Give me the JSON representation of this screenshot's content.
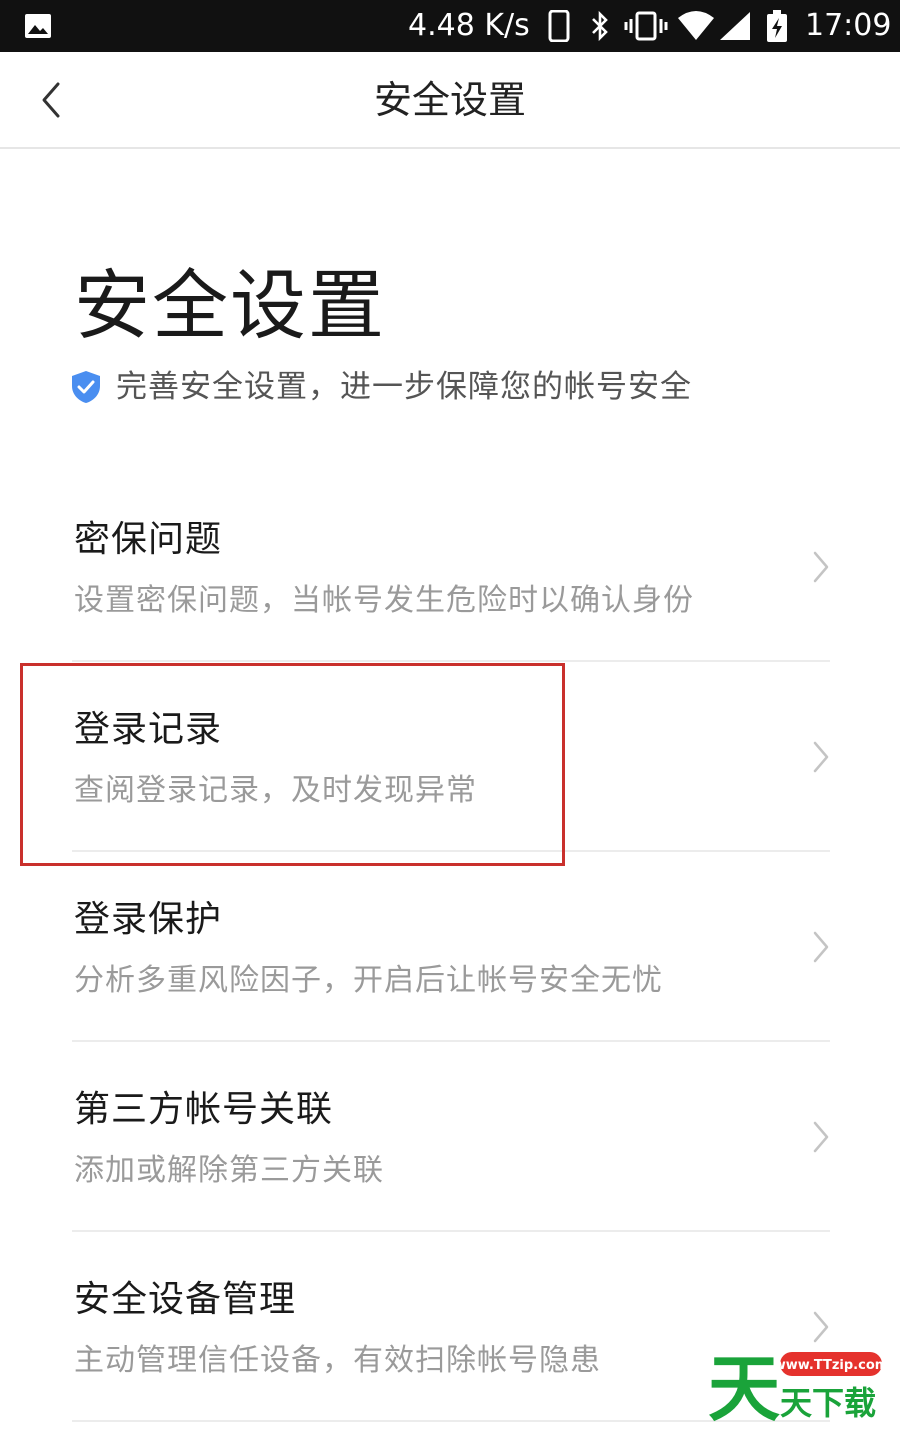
{
  "status_bar": {
    "net_speed": "4.48 K/s",
    "time": "17:09",
    "icons": [
      "gallery-icon",
      "phone-icon",
      "bluetooth-icon",
      "vibrate-icon",
      "wifi-icon",
      "signal-icon",
      "battery-charging-icon"
    ]
  },
  "nav": {
    "title": "安全设置",
    "back_icon": "chevron-left-icon"
  },
  "header": {
    "heading": "安全设置",
    "subtitle": "完善安全设置，进一步保障您的帐号安全",
    "subtitle_icon": "shield-check-icon"
  },
  "items": [
    {
      "title": "密保问题",
      "desc": "设置密保问题，当帐号发生危险时以确认身份"
    },
    {
      "title": "登录记录",
      "desc": "查阅登录记录，及时发现异常"
    },
    {
      "title": "登录保护",
      "desc": "分析多重风险因子，开启后让帐号安全无忧"
    },
    {
      "title": "第三方帐号关联",
      "desc": "添加或解除第三方关联"
    },
    {
      "title": "安全设备管理",
      "desc": "主动管理信任设备，有效扫除帐号隐患"
    }
  ],
  "watermark": {
    "url": "www.TTzip.com",
    "big_char": "天",
    "text": "天下载"
  },
  "colors": {
    "accent_blue": "#4a8ef0",
    "highlight_red": "#c9302c",
    "watermark_green": "#1aa33a"
  }
}
